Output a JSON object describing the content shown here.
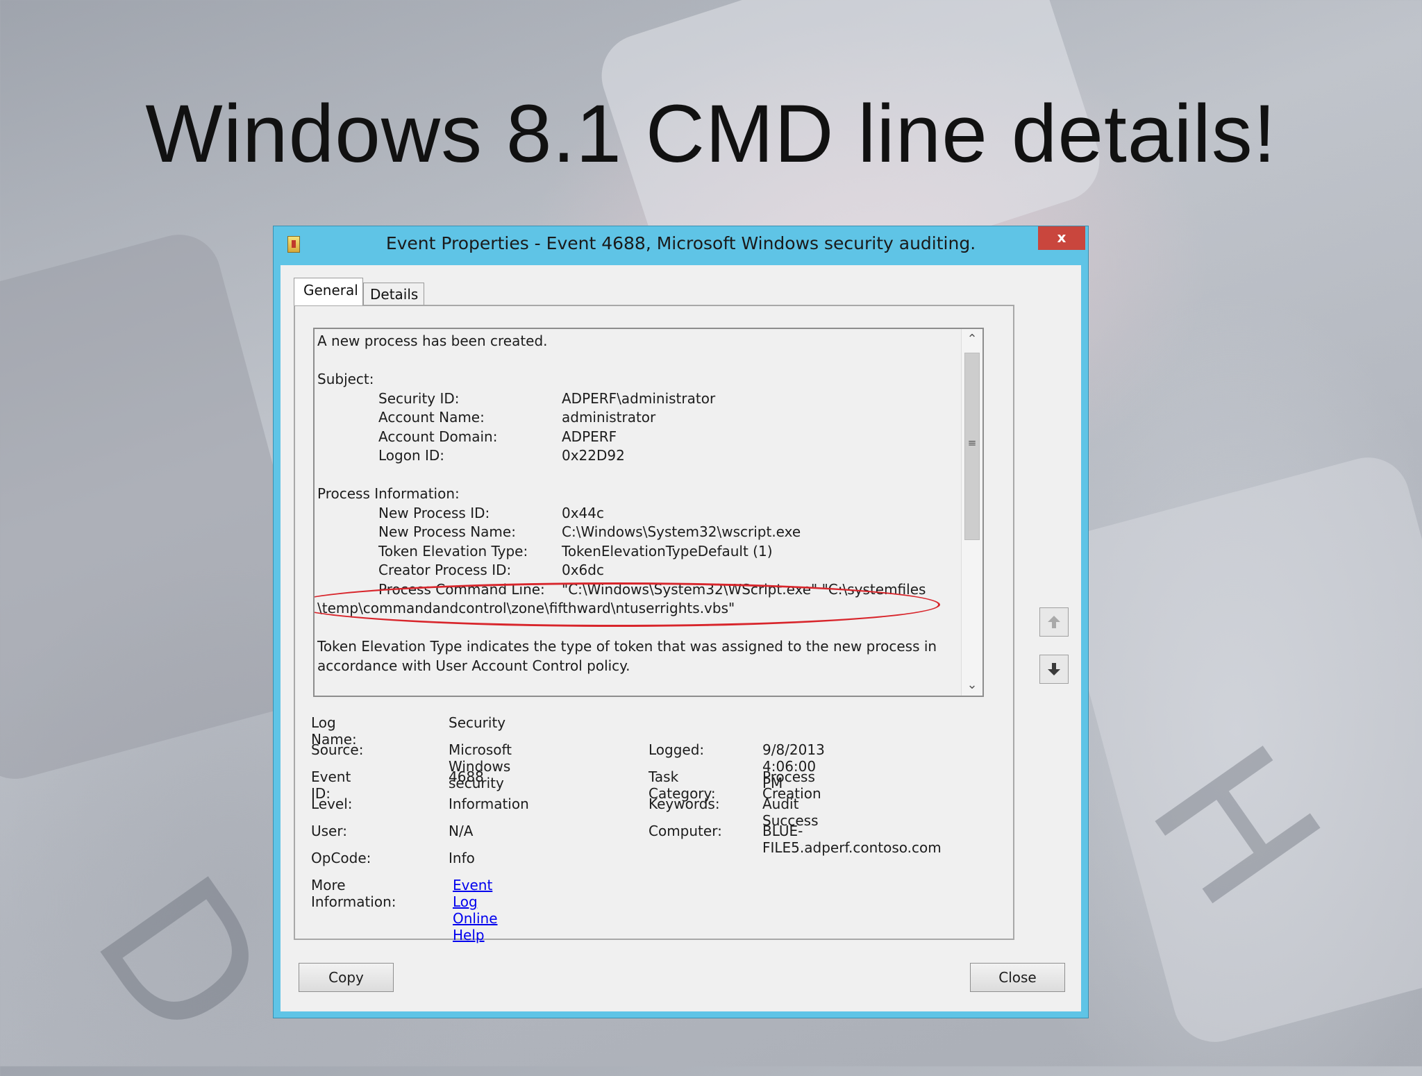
{
  "slide": {
    "title": "Windows 8.1 CMD line details!"
  },
  "window": {
    "title": "Event Properties - Event 4688, Microsoft Windows security auditing.",
    "close_glyph": "x"
  },
  "tabs": [
    {
      "label": "General"
    },
    {
      "label": "Details"
    }
  ],
  "event_description": [
    "A new process has been created.",
    "",
    "Subject:",
    "\t\tSecurity ID:\t\tADPERF\\administrator",
    "\t\tAccount Name:\t\tadministrator",
    "\t\tAccount Domain:\t\tADPERF",
    "\t\tLogon ID:\t\t0x22D92",
    "",
    "Process Information:",
    "\t\tNew Process ID:\t\t0x44c",
    "\t\tNew Process Name:\t\tC:\\Windows\\System32\\wscript.exe",
    "\t\tToken Elevation Type:\t\tTokenElevationTypeDefault (1)",
    "\t\tCreator Process ID:\t\t0x6dc",
    "\t\tProcess Command Line:\t\t\"C:\\Windows\\System32\\WScript.exe\" \"C:\\systemfiles",
    "\\temp\\commandandcontrol\\zone\\fifthward\\ntuserrights.vbs\"",
    "",
    "Token Elevation Type indicates the type of token that was assigned to the new process in",
    "accordance with User Account Control policy."
  ],
  "properties": {
    "log_name": {
      "label": "Log Name:",
      "value": "Security"
    },
    "source": {
      "label": "Source:",
      "value": "Microsoft Windows security"
    },
    "logged": {
      "label": "Logged:",
      "value": "9/8/2013 4:06:00 PM"
    },
    "event_id": {
      "label": "Event ID:",
      "value": "4688"
    },
    "task_category": {
      "label": "Task Category:",
      "value": "Process Creation"
    },
    "level": {
      "label": "Level:",
      "value": "Information"
    },
    "keywords": {
      "label": "Keywords:",
      "value": "Audit Success"
    },
    "user": {
      "label": "User:",
      "value": "N/A"
    },
    "computer": {
      "label": "Computer:",
      "value": "BLUE-FILE5.adperf.contoso.com"
    },
    "opcode": {
      "label": "OpCode:",
      "value": "Info"
    },
    "more_info": {
      "label": "More Information:",
      "link": "Event Log Online Help"
    }
  },
  "buttons": {
    "copy": "Copy",
    "close": "Close"
  },
  "colors": {
    "title_bar": "#5fc4e6",
    "highlight_ring": "#d8252b",
    "link": "#0000ee"
  }
}
